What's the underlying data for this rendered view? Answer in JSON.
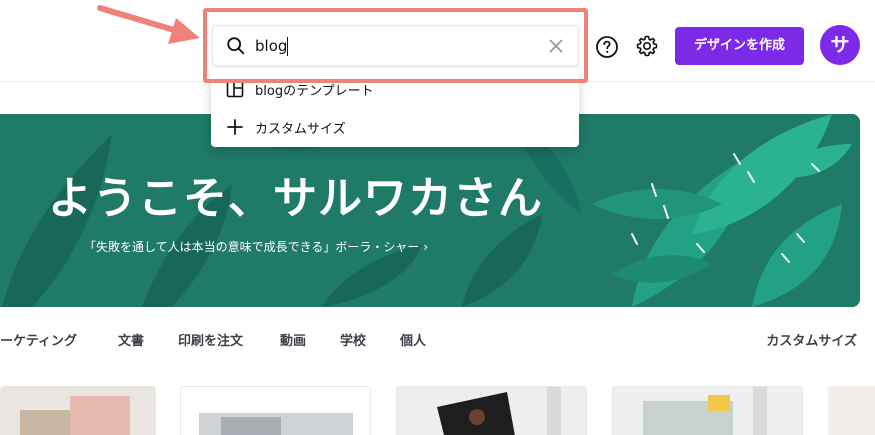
{
  "search": {
    "value": "blog",
    "placeholder": ""
  },
  "header": {
    "create_label": "デザインを作成",
    "avatar_letter": "サ"
  },
  "dropdown": {
    "items": [
      {
        "label": "blogのテンプレート",
        "icon": "template-icon"
      },
      {
        "label": "カスタムサイズ",
        "icon": "plus-icon"
      }
    ]
  },
  "hero": {
    "title": "ようこそ、サルワカさん",
    "quote": "「失敗を通して人は本当の意味で成長できる」ボーラ・シャー ›"
  },
  "tabs": {
    "items": [
      "ーケティング",
      "文書",
      "印刷を注文",
      "動画",
      "学校",
      "個人"
    ],
    "right": "カスタムサイズ"
  },
  "colors": {
    "accent": "#7d2ae8",
    "hero_bg": "#1f7a67",
    "highlight": "#f0827a"
  }
}
